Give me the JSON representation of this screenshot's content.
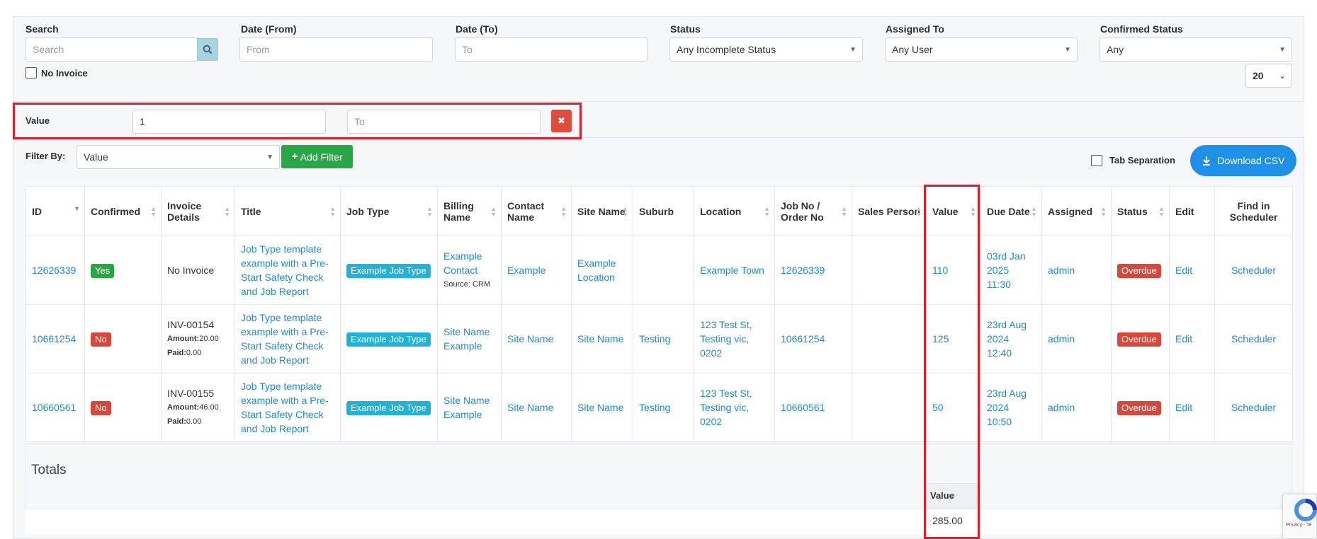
{
  "filters": {
    "search_label": "Search",
    "search_placeholder": "Search",
    "date_from_label": "Date (From)",
    "date_from_placeholder": "From",
    "date_to_label": "Date (To)",
    "date_to_placeholder": "To",
    "status_label": "Status",
    "status_value": "Any Incomplete Status",
    "assigned_label": "Assigned To",
    "assigned_value": "Any User",
    "confirmed_label": "Confirmed Status",
    "confirmed_value": "Any",
    "no_invoice_label": "No Invoice",
    "page_size": "20"
  },
  "value_filter": {
    "label": "Value",
    "from_value": "1",
    "to_placeholder": "To",
    "remove_icon": "✖"
  },
  "filter_by": {
    "label": "Filter By:",
    "selected": "Value",
    "add_button": "Add Filter"
  },
  "tab_separation_label": "Tab Separation",
  "download_label": "Download CSV",
  "columns": [
    "ID",
    "Confirmed",
    "Invoice Details",
    "Title",
    "Job Type",
    "Billing Name",
    "Contact Name",
    "Site Name",
    "Suburb",
    "Location",
    "Job No / Order No",
    "Sales Person",
    "Value",
    "Due Date",
    "Assigned",
    "Status",
    "Edit",
    "Find in Scheduler"
  ],
  "rows": [
    {
      "id": "12626339",
      "confirmed": "Yes",
      "confirmed_color": "#28a745",
      "invoice": "No Invoice",
      "amount_label": "",
      "amount": "",
      "paid_label": "",
      "paid": "",
      "title": "Job Type template example with a Pre-Start Safety Check and Job Report",
      "job_type": "Example Job Type",
      "billing_name": "Example Contact",
      "billing_source": "Source: CRM",
      "contact_name": "Example",
      "site_name": "Example Location",
      "suburb": "",
      "location": "Example Town",
      "job_no": "12626339",
      "sales_person": "",
      "value": "110",
      "due_date": "03rd Jan 2025 11:30",
      "assigned": "admin",
      "status": "Overdue",
      "edit": "Edit",
      "scheduler": "Scheduler"
    },
    {
      "id": "10661254",
      "confirmed": "No",
      "confirmed_color": "#d9463a",
      "invoice": "INV-00154",
      "amount_label": "Amount:",
      "amount": "20.00",
      "paid_label": "Paid:",
      "paid": "0.00",
      "title": "Job Type template example with a Pre-Start Safety Check and Job Report",
      "job_type": "Example Job Type",
      "billing_name": "Site Name Example",
      "billing_source": "",
      "contact_name": "Site Name",
      "site_name": "Site Name",
      "suburb": "Testing",
      "location": "123 Test St, Testing vic, 0202",
      "job_no": "10661254",
      "sales_person": "",
      "value": "125",
      "due_date": "23rd Aug 2024 12:40",
      "assigned": "admin",
      "status": "Overdue",
      "edit": "Edit",
      "scheduler": "Scheduler"
    },
    {
      "id": "10660561",
      "confirmed": "No",
      "confirmed_color": "#d9463a",
      "invoice": "INV-00155",
      "amount_label": "Amount:",
      "amount": "46.00",
      "paid_label": "Paid:",
      "paid": "0.00",
      "title": "Job Type template example with a Pre-Start Safety Check and Job Report",
      "job_type": "Example Job Type",
      "billing_name": "Site Name Example",
      "billing_source": "",
      "contact_name": "Site Name",
      "site_name": "Site Name",
      "suburb": "Testing",
      "location": "123 Test St, Testing vic, 0202",
      "job_no": "10660561",
      "sales_person": "",
      "value": "50",
      "due_date": "23rd Aug 2024 10:50",
      "assigned": "admin",
      "status": "Overdue",
      "edit": "Edit",
      "scheduler": "Scheduler"
    }
  ],
  "totals": {
    "label": "Totals",
    "value_header": "Value",
    "value_total": "285.00"
  },
  "recaptcha_text": "Privacy - Te"
}
